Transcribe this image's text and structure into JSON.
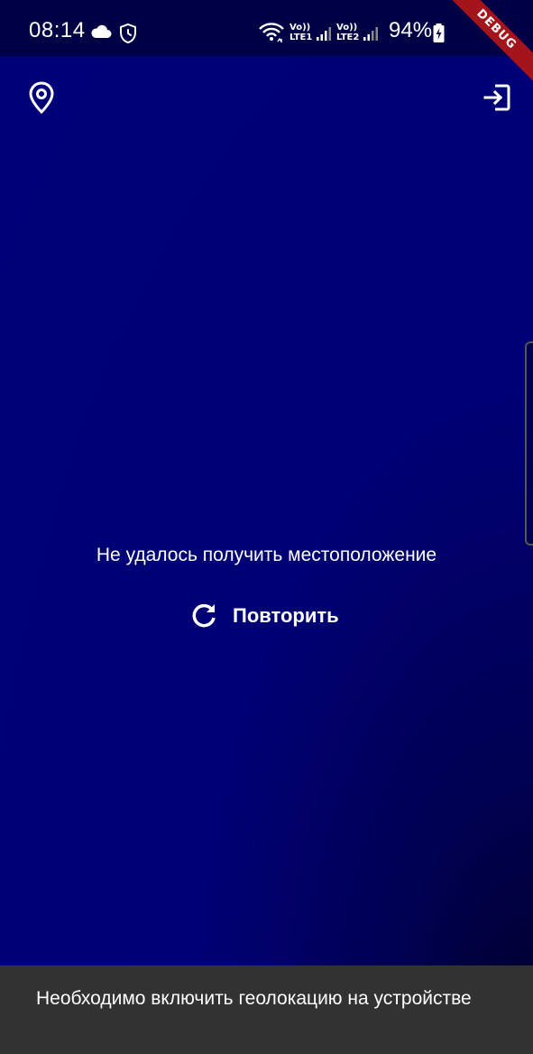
{
  "status_bar": {
    "time": "08:14",
    "lte1_top": "Vo))",
    "lte1_bottom": "LTE1",
    "lte2_top": "Vo))",
    "lte2_bottom": "LTE2",
    "battery": "94%",
    "icons": [
      "cloud-icon",
      "shield-clock-icon",
      "wifi-icon",
      "signal-icon",
      "battery-charging-icon"
    ]
  },
  "debug_banner": "DEBUG",
  "toolbar": {
    "location_icon": "location-pin-icon",
    "exit_icon": "exit-icon"
  },
  "main": {
    "error_message": "Не удалось получить местоположение",
    "retry_label": "Повторить",
    "retry_icon": "refresh-icon"
  },
  "snackbar": {
    "message": "Необходимо включить геолокацию на устройстве"
  },
  "colors": {
    "background": "#000075",
    "status_bar": "#000045",
    "snackbar": "#323232",
    "debug_ribbon": "#a4141b"
  }
}
